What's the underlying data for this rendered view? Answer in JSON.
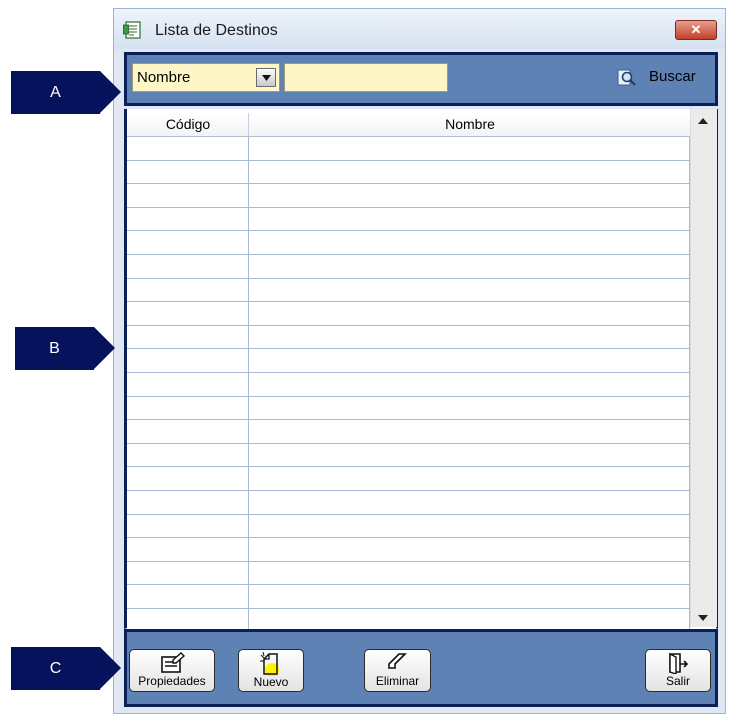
{
  "window": {
    "title": "Lista de Destinos",
    "close_label": "✕"
  },
  "search": {
    "field_selected": "Nombre",
    "query_value": "",
    "button_label": "Buscar"
  },
  "table": {
    "columns": [
      "Código",
      "Nombre"
    ],
    "row_count": 20
  },
  "actions": {
    "properties_label": "Propiedades",
    "new_label": "Nuevo",
    "delete_label": "Eliminar",
    "exit_label": "Salir"
  },
  "callouts": {
    "a": "A",
    "b": "B",
    "c": "C"
  },
  "colors": {
    "panel": "#5f82b4",
    "panel_border": "#0b1f57",
    "field_bg": "#fff6c8",
    "callout_bg": "#06125c",
    "close_button": "#c0402a"
  },
  "icons": {
    "app": "document-dollar-icon",
    "search": "magnifier-icon",
    "properties": "edit-document-icon",
    "new": "new-document-icon",
    "delete": "eraser-icon",
    "exit": "exit-door-icon"
  }
}
